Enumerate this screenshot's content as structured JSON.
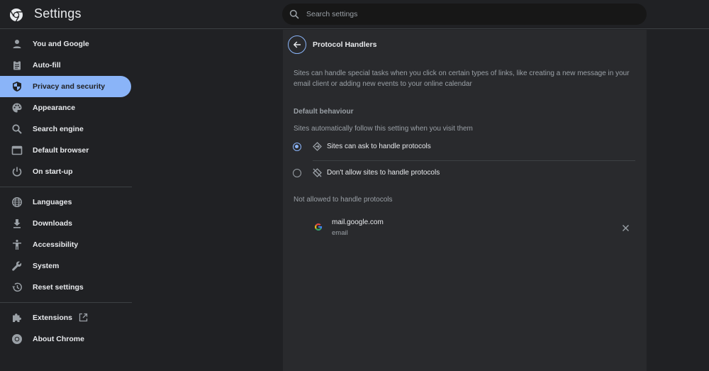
{
  "header": {
    "title": "Settings",
    "logo_icon": "chrome-logo-icon",
    "search": {
      "placeholder": "Search settings",
      "value": "",
      "icon": "search-icon"
    }
  },
  "sidebar": {
    "groups": [
      [
        {
          "label": "You and Google",
          "icon": "person-icon",
          "active": false
        },
        {
          "label": "Auto-fill",
          "icon": "clipboard-icon",
          "active": false
        },
        {
          "label": "Privacy and security",
          "icon": "shield-icon",
          "active": true
        },
        {
          "label": "Appearance",
          "icon": "palette-icon",
          "active": false
        },
        {
          "label": "Search engine",
          "icon": "search-icon",
          "active": false
        },
        {
          "label": "Default browser",
          "icon": "browser-icon",
          "active": false
        },
        {
          "label": "On start-up",
          "icon": "power-icon",
          "active": false
        }
      ],
      [
        {
          "label": "Languages",
          "icon": "globe-icon",
          "active": false
        },
        {
          "label": "Downloads",
          "icon": "download-icon",
          "active": false
        },
        {
          "label": "Accessibility",
          "icon": "accessibility-icon",
          "active": false
        },
        {
          "label": "System",
          "icon": "wrench-icon",
          "active": false
        },
        {
          "label": "Reset settings",
          "icon": "history-icon",
          "active": false
        }
      ],
      [
        {
          "label": "Extensions",
          "icon": "puzzle-icon",
          "active": false
        },
        {
          "label": "About Chrome",
          "icon": "chrome-icon",
          "active": false
        }
      ]
    ]
  },
  "main": {
    "title": "Protocol Handlers",
    "description": "Sites can handle special tasks when you click on certain types of links, like creating a new message in your email client or adding new events to your online calendar",
    "default_behaviour": {
      "heading": "Default behaviour",
      "subheading": "Sites automatically follow this setting when you visit them",
      "options": [
        {
          "label": "Sites can ask to handle protocols",
          "icon": "protocol-handler-icon",
          "checked": true
        },
        {
          "label": "Don't allow sites to handle protocols",
          "icon": "protocol-handler-off-icon",
          "checked": false
        }
      ]
    },
    "not_allowed": {
      "heading": "Not allowed to handle protocols",
      "sites": [
        {
          "site": "mail.google.com",
          "protocol": "email",
          "favicon": "google-favicon-icon"
        }
      ]
    }
  },
  "colors": {
    "background": "#202124",
    "card": "#292a2d",
    "accent": "#8ab4f8",
    "text_primary": "#e8eaed",
    "text_secondary": "#9aa0a6"
  }
}
